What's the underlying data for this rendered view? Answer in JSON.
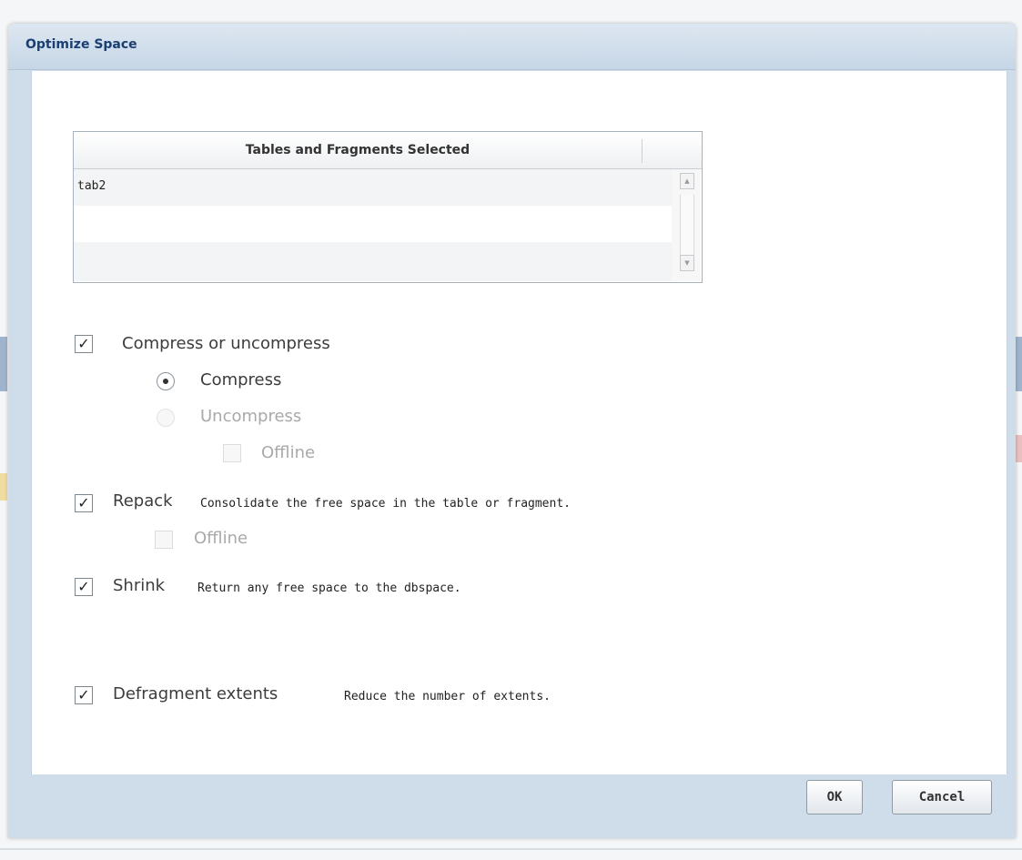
{
  "dialog": {
    "title": "Optimize Space",
    "table": {
      "header": "Tables and Fragments Selected",
      "rows": [
        "tab2",
        "",
        ""
      ]
    },
    "options": {
      "compress": {
        "label": "Compress or uncompress",
        "checked": true,
        "radio_compress": "Compress",
        "radio_uncompress": "Uncompress",
        "offline": "Offline"
      },
      "repack": {
        "label": "Repack",
        "description": "Consolidate the free space in the table or fragment.",
        "checked": true,
        "offline": "Offline"
      },
      "shrink": {
        "label": "Shrink",
        "description": "Return any free space to the dbspace.",
        "checked": true
      },
      "defragment": {
        "label": "Defragment extents",
        "description": "Reduce the number of extents.",
        "checked": true
      }
    },
    "buttons": {
      "ok": "OK",
      "cancel": "Cancel"
    }
  },
  "icons": {
    "checkmark": "✓",
    "scroll_up": "▲",
    "scroll_down": "▼"
  },
  "colors": {
    "title_text": "#1b3f73",
    "dialog_frame": "#cfdcea"
  }
}
